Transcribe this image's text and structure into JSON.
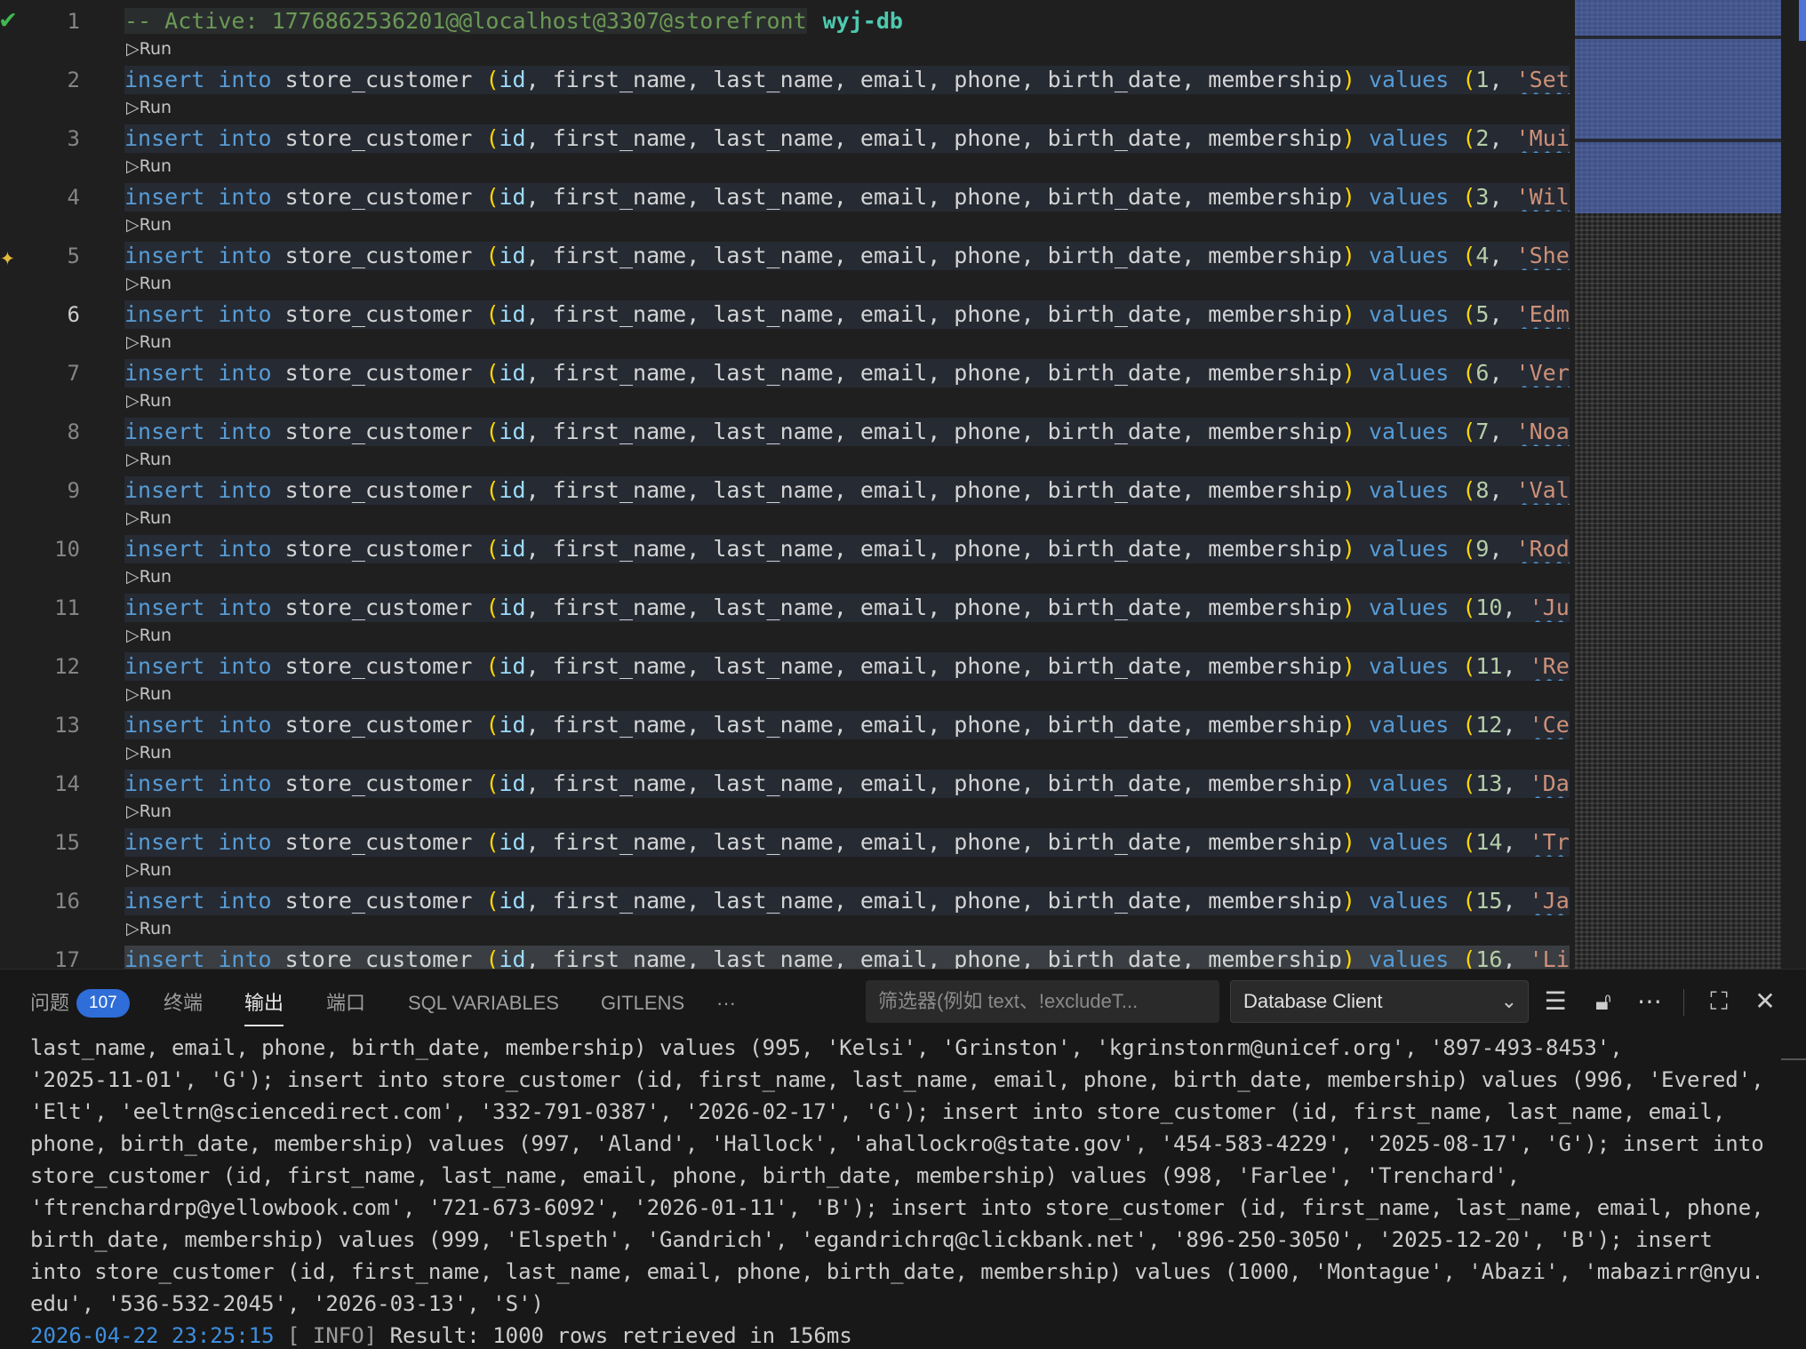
{
  "editor": {
    "header": {
      "line_no": "1",
      "comment": "-- Active: 1776862536201@@localhost@3307@storefront",
      "db_tag": "wyj-db"
    },
    "codelens_label": "▷Run",
    "keywords": {
      "insert": "insert",
      "into": "into",
      "values": "values"
    },
    "table": "store_customer",
    "columns": [
      "id",
      "first_name",
      "last_name",
      "email",
      "phone",
      "birth_date",
      "membership"
    ],
    "rows": [
      {
        "line": "2",
        "id": "1",
        "name": "'Seth',"
      },
      {
        "line": "3",
        "id": "2",
        "name": "'Muire',"
      },
      {
        "line": "4",
        "id": "3",
        "name": "'Willabe'"
      },
      {
        "line": "5",
        "id": "4",
        "name": "'Sherm',"
      },
      {
        "line": "6",
        "id": "5",
        "name": "'Edmon',"
      },
      {
        "line": "7",
        "id": "6",
        "name": "'Vernen',"
      },
      {
        "line": "8",
        "id": "7",
        "name": "'Noam',"
      },
      {
        "line": "9",
        "id": "8",
        "name": "'Valentir"
      },
      {
        "line": "10",
        "id": "9",
        "name": "'Roddie',"
      },
      {
        "line": "11",
        "id": "10",
        "name": "'Juliet"
      },
      {
        "line": "12",
        "id": "11",
        "name": "'Reba',"
      },
      {
        "line": "13",
        "id": "12",
        "name": "'Celia',"
      },
      {
        "line": "14",
        "id": "13",
        "name": "'Dasha',"
      },
      {
        "line": "15",
        "id": "14",
        "name": "'Tris',"
      },
      {
        "line": "16",
        "id": "15",
        "name": "'Janina"
      },
      {
        "line": "17",
        "id": "16",
        "name": "'Lisle',"
      }
    ],
    "active_line": "6",
    "gutter_icons": {
      "line1": "checkmark-icon",
      "line5": "sparkle-icon"
    },
    "colors": {
      "keyword": "#569cd6",
      "paren": "#ffd700",
      "string": "#ce9178",
      "comment": "#6a9955",
      "db_tag": "#4ec9b0"
    }
  },
  "panel": {
    "tabs": [
      {
        "label": "问题",
        "badge": "107"
      },
      {
        "label": "终端"
      },
      {
        "label": "输出",
        "active": true
      },
      {
        "label": "端口"
      },
      {
        "label": "SQL VARIABLES"
      },
      {
        "label": "GITLENS"
      },
      {
        "label": "···"
      }
    ],
    "filter_placeholder": "筛选器(例如 text、!excludeT...",
    "channel": "Database Client",
    "icons": [
      "chevron-down-icon",
      "wrap-lines-icon",
      "lock-icon",
      "more-icon",
      "maximize-icon",
      "close-icon"
    ],
    "output_lines": [
      "last_name, email, phone, birth_date, membership) values (995, 'Kelsi', 'Grinston', 'kgrinstonrm@unicef.org', '897-493-8453',",
      "'2025-11-01', 'G'); insert into store_customer (id, first_name, last_name, email, phone, birth_date, membership) values (996, 'Evered',",
      "'Elt', 'eeltrn@sciencedirect.com', '332-791-0387', '2026-02-17', 'G'); insert into store_customer (id, first_name, last_name, email,",
      "phone, birth_date, membership) values (997, 'Aland', 'Hallock', 'ahallockro@state.gov', '454-583-4229', '2025-08-17', 'G'); insert into",
      "store_customer (id, first_name, last_name, email, phone, birth_date, membership) values (998, 'Farlee', 'Trenchard',",
      "'ftrenchardrp@yellowbook.com', '721-673-6092', '2026-01-11', 'B'); insert into store_customer (id, first_name, last_name, email, phone,",
      "birth_date, membership) values (999, 'Elspeth', 'Gandrich', 'egandrichrq@clickbank.net', '896-250-3050', '2025-12-20', 'B'); insert",
      "into store_customer (id, first_name, last_name, email, phone, birth_date, membership) values (1000, 'Montague', 'Abazi', 'mabazirr@nyu.",
      "edu', '536-532-2045', '2026-03-13', 'S')"
    ],
    "result": {
      "timestamp": "2026-04-22 23:25:15",
      "level": "[ INFO]",
      "message": "Result: 1000 rows retrieved in 156ms"
    }
  }
}
